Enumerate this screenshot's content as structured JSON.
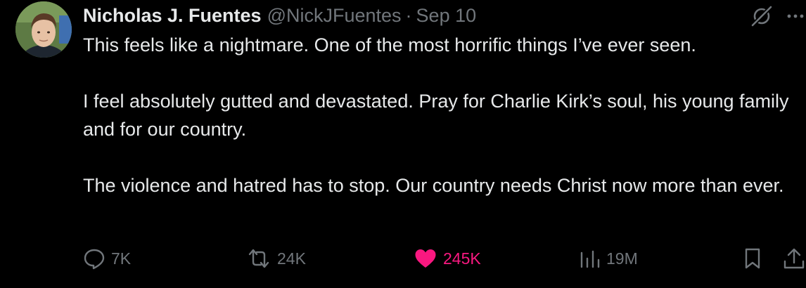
{
  "author": {
    "display_name": "Nicholas J. Fuentes",
    "handle": "@NickJFuentes",
    "separator": "·",
    "timestamp": "Sep 10"
  },
  "tweet": {
    "paragraphs": [
      "This feels like a nightmare. One of the most horrific things I’ve ever seen.",
      "I feel absolutely gutted and devastated. Pray for Charlie Kirk’s soul, his young family and for our country.",
      "The violence and hatred has to stop. Our country needs Christ now more than ever."
    ]
  },
  "actions": {
    "replies": "7K",
    "reposts": "24K",
    "likes": "245K",
    "views": "19M"
  },
  "icons": {
    "header": [
      "grok-icon",
      "more-icon"
    ],
    "actions": [
      "reply-icon",
      "repost-icon",
      "like-icon",
      "views-icon",
      "bookmark-icon",
      "share-icon"
    ]
  },
  "colors": {
    "background": "#000000",
    "text_primary": "#e7e9ea",
    "text_secondary": "#71767b",
    "like_active": "#f91880"
  }
}
